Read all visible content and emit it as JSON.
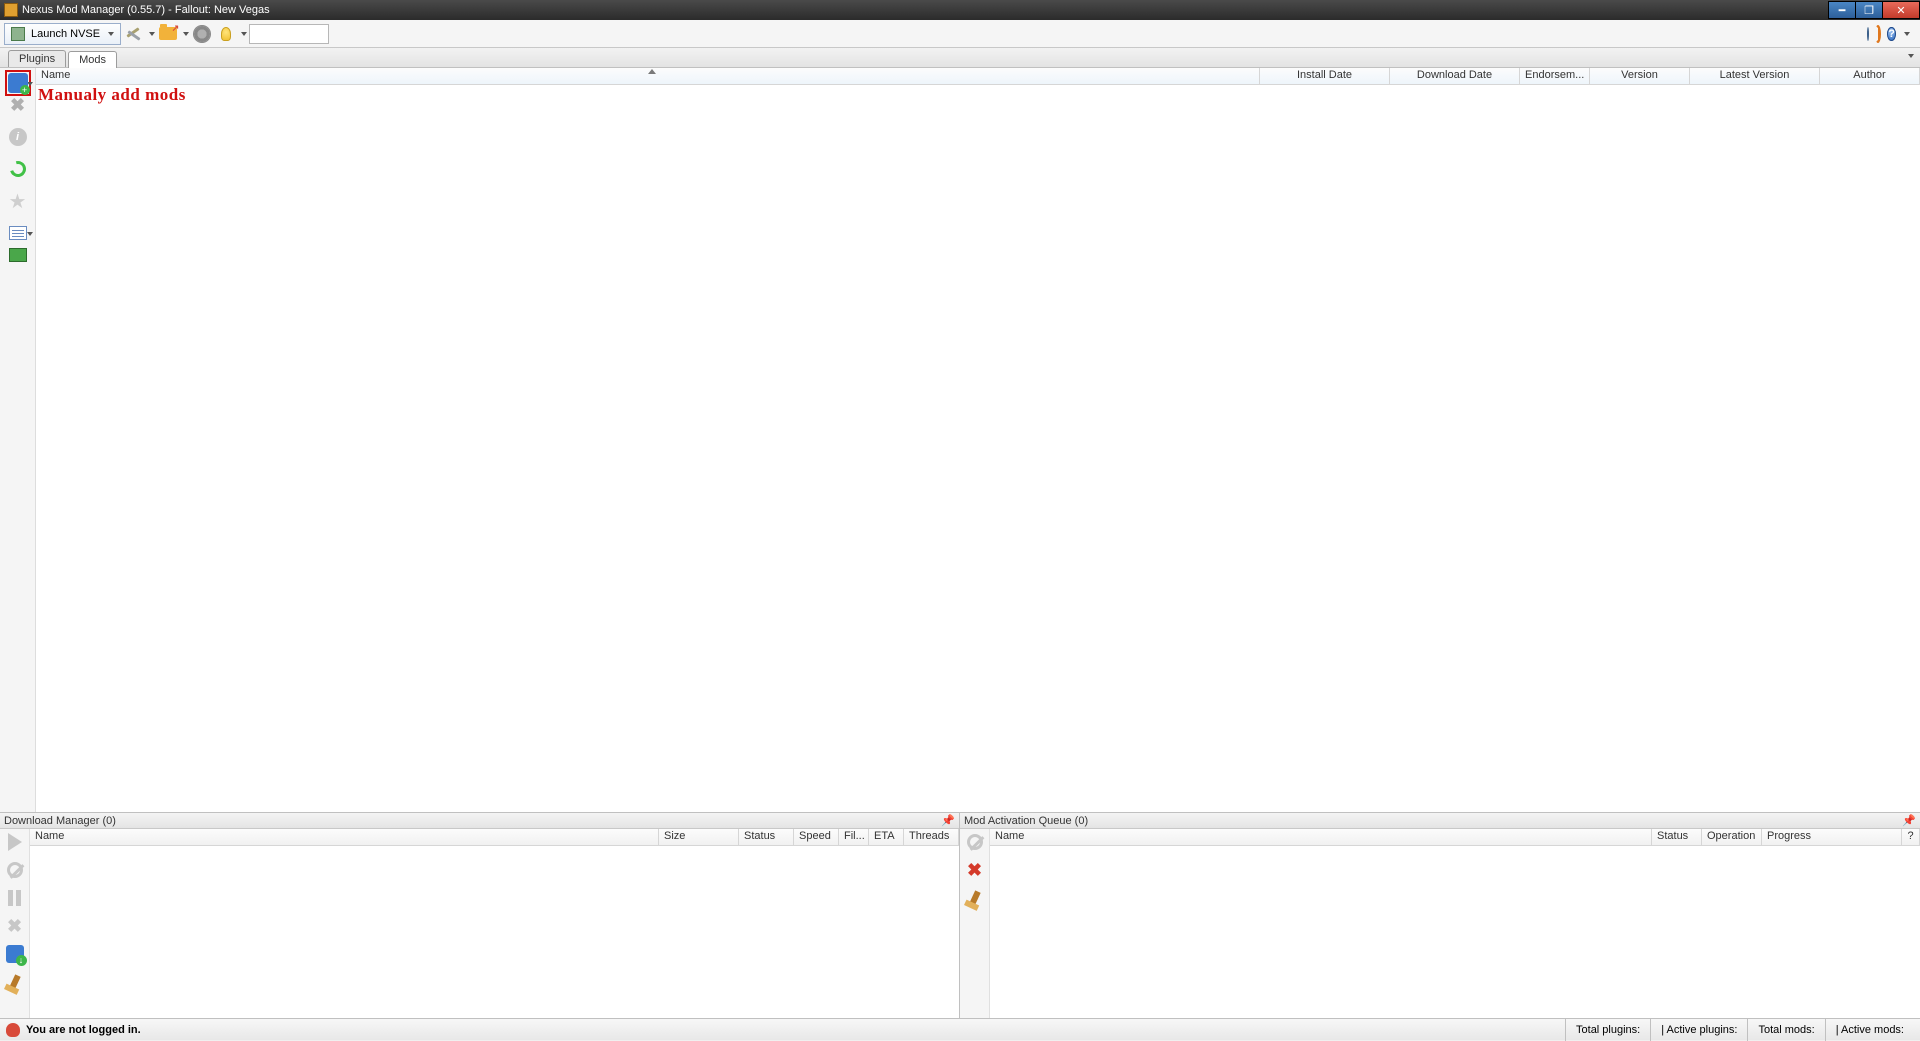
{
  "window": {
    "title": "Nexus Mod Manager (0.55.7) - Fallout: New Vegas"
  },
  "toolbar": {
    "launch_label": "Launch NVSE"
  },
  "tabs": {
    "plugins": "Plugins",
    "mods": "Mods"
  },
  "columns": {
    "name": "Name",
    "install": "Install Date",
    "download": "Download Date",
    "endorse": "Endorsem...",
    "version": "Version",
    "latest": "Latest Version",
    "author": "Author"
  },
  "annotation": "Manualy add mods",
  "downloadPanel": {
    "title": "Download Manager (0)",
    "cols": {
      "name": "Name",
      "size": "Size",
      "status": "Status",
      "speed": "Speed",
      "fil": "Fil...",
      "eta": "ETA",
      "threads": "Threads"
    }
  },
  "queuePanel": {
    "title": "Mod Activation Queue (0)",
    "cols": {
      "name": "Name",
      "status": "Status",
      "operation": "Operation",
      "progress": "Progress",
      "q": "?"
    }
  },
  "status": {
    "login": "You are not logged in.",
    "totalPlugins": "Total plugins:",
    "activePlugins": "|  Active plugins:",
    "totalMods": "Total mods:",
    "activeMods": "|  Active mods:"
  }
}
